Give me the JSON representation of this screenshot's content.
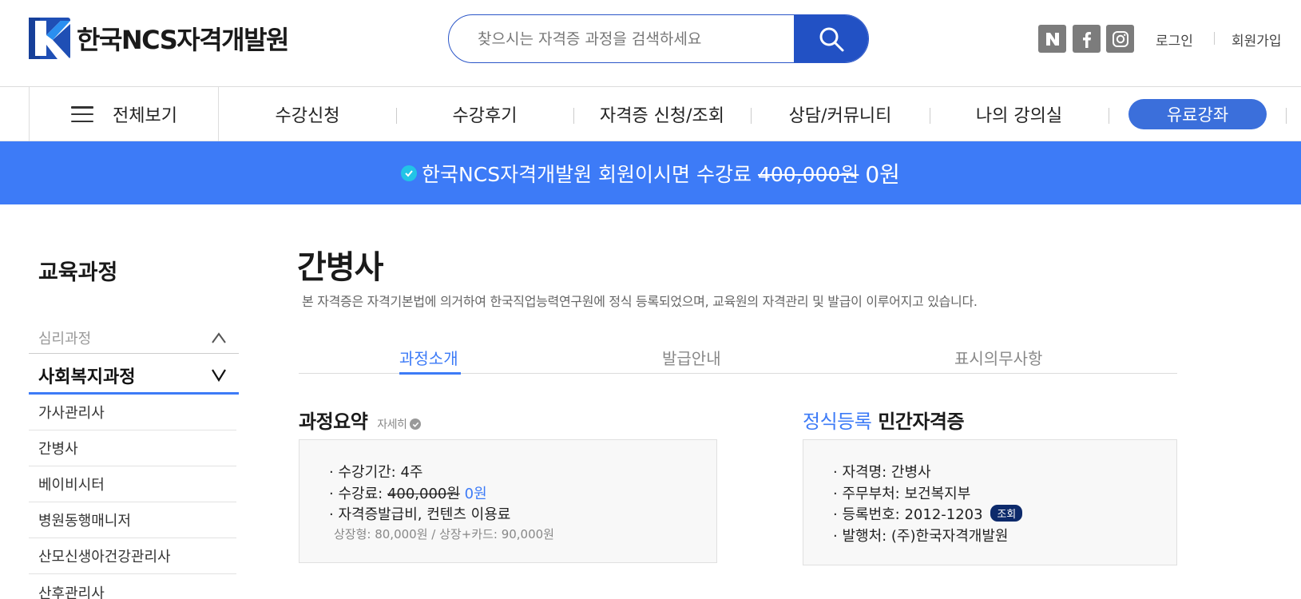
{
  "header": {
    "logo_text": "한국NCS자격개발원",
    "search_placeholder": "찾으시는 자격증 과정을 검색하세요",
    "sns": [
      {
        "icon": "naver-icon",
        "glyph": "N"
      },
      {
        "icon": "facebook-icon",
        "glyph": "f"
      },
      {
        "icon": "instagram-icon",
        "glyph": ""
      }
    ],
    "login_label": "로그인",
    "signup_label": "회원가입"
  },
  "nav": {
    "all_label": "전체보기",
    "items": [
      "수강신청",
      "수강후기",
      "자격증 신청/조회",
      "상담/커뮤니티",
      "나의 강의실"
    ],
    "paid_label": "유료강좌"
  },
  "banner": {
    "text": "한국NCS자격개발원 회원이시면 수강료",
    "original_price": "400,000원",
    "price": "0원"
  },
  "sidebar": {
    "title": "교육과정",
    "group_psychology": "심리과정",
    "group_social": "사회복지과정",
    "items": [
      "가사관리사",
      "간병사",
      "베이비시터",
      "병원동행매니저",
      "산모신생아건강관리사",
      "산후관리사"
    ]
  },
  "main": {
    "title": "간병사",
    "description": "본 자격증은 자격기본법에 의거하여 한국직업능력연구원에 정식 등록되었으며, 교육원의 자격관리 및 발급이 이루어지고 있습니다.",
    "tabs": [
      "과정소개",
      "발급안내",
      "표시의무사항"
    ],
    "summary": {
      "title": "과정요약",
      "detail_label": "자세히",
      "period": "· 수강기간: 4주",
      "fee_label": "· 수강료:",
      "fee_original": "400,000원",
      "fee_price": "0원",
      "extra": "· 자격증발급비, 컨텐츠 이용료",
      "extra_sub": "상장형: 80,000원 / 상장+카드: 90,000원"
    },
    "registration": {
      "title_blue": "정식등록",
      "title_rest": "민간자격증",
      "name": "· 자격명: 간병사",
      "ministry": "· 주무부처: 보건복지부",
      "number_label": "· 등록번호: 2012-1203",
      "lookup_label": "조회",
      "issuer": "· 발행처: (주)한국자격개발원"
    }
  },
  "colors": {
    "accent": "#3d7bf7",
    "search_button": "#2251c4",
    "badge": "#0d2a6b"
  }
}
